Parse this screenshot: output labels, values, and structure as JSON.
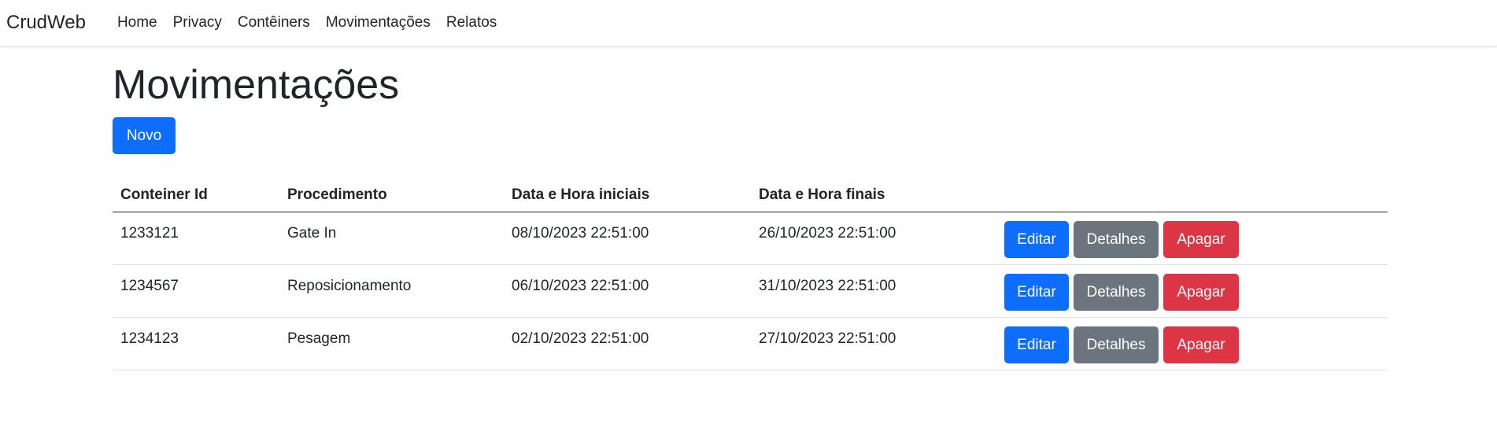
{
  "navbar": {
    "brand": "CrudWeb",
    "links": [
      "Home",
      "Privacy",
      "Contêiners",
      "Movimentações",
      "Relatos"
    ]
  },
  "page": {
    "title": "Movimentações",
    "new_button": "Novo"
  },
  "table": {
    "headers": [
      "Conteiner Id",
      "Procedimento",
      "Data e Hora iniciais",
      "Data e Hora finais"
    ],
    "rows": [
      [
        "1233121",
        "Gate In",
        "08/10/2023 22:51:00",
        "26/10/2023 22:51:00"
      ],
      [
        "1234567",
        "Reposicionamento",
        "06/10/2023 22:51:00",
        "31/10/2023 22:51:00"
      ],
      [
        "1234123",
        "Pesagem",
        "02/10/2023 22:51:00",
        "27/10/2023 22:51:00"
      ]
    ],
    "actions": {
      "edit": "Editar",
      "details": "Detalhes",
      "delete": "Apagar"
    }
  },
  "colors": {
    "primary": "#0d6efd",
    "secondary": "#6c757d",
    "danger": "#dc3545"
  }
}
